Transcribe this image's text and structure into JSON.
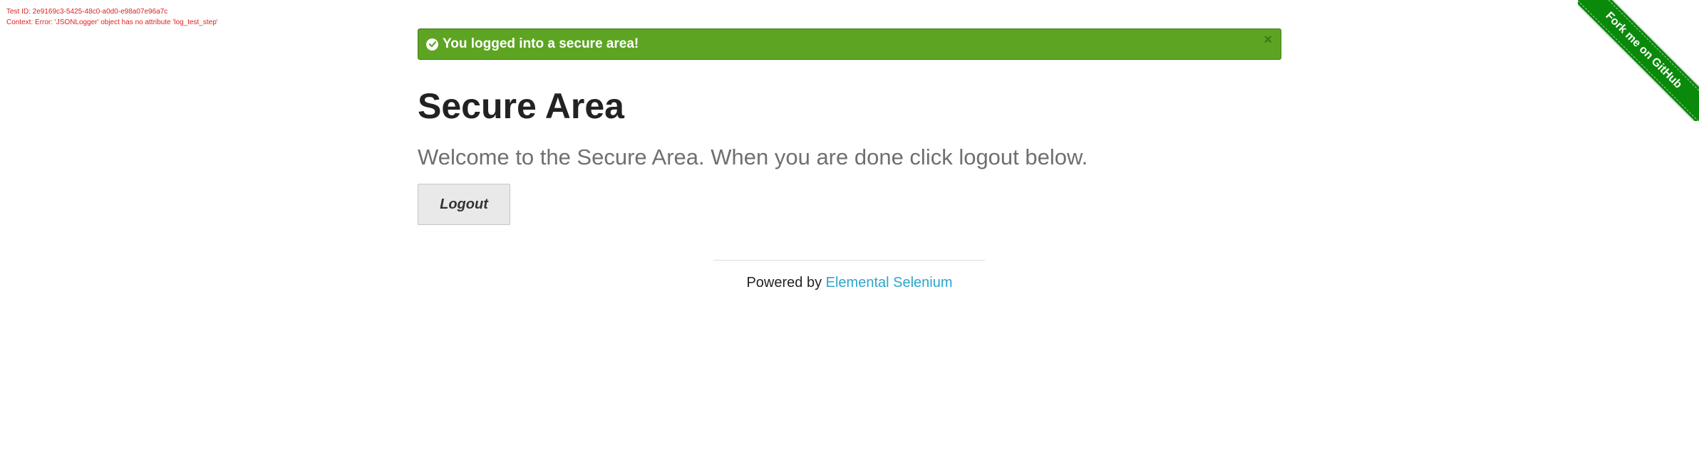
{
  "debug": {
    "test_id_line": "Test ID: 2e9169c3-5425-48c0-a0d0-e98a07e96a7c",
    "context_line": "Context: Error: 'JSONLogger' object has no attribute 'log_test_step'"
  },
  "flash": {
    "message": "You logged into a secure area!",
    "close_symbol": "×",
    "icon": "check-circle-icon",
    "color": "#5da423"
  },
  "page": {
    "title": "Secure Area",
    "subtitle": "Welcome to the Secure Area. When you are done click logout below."
  },
  "logout_button": {
    "label": "Logout"
  },
  "footer": {
    "prefix": "Powered by ",
    "link_text": "Elemental Selenium",
    "link_color": "#2ba6cb"
  },
  "ribbon": {
    "label": "Fork me on GitHub",
    "color": "#0a8a0a"
  }
}
